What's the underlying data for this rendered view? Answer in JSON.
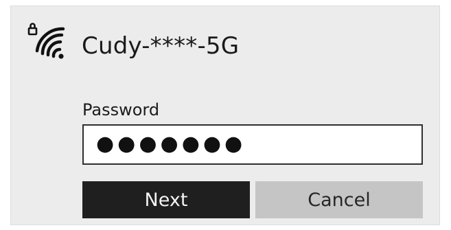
{
  "network": {
    "ssid": "Cudy-****-5G",
    "icon": "secured-wifi-icon"
  },
  "password": {
    "label": "Password",
    "masked_value": "●●●●●●●"
  },
  "actions": {
    "next_label": "Next",
    "cancel_label": "Cancel"
  },
  "colors": {
    "panel_bg": "#ececec",
    "next_bg": "#1f1f1f",
    "cancel_bg": "#c5c5c5",
    "field_border": "#2f2f2f"
  }
}
